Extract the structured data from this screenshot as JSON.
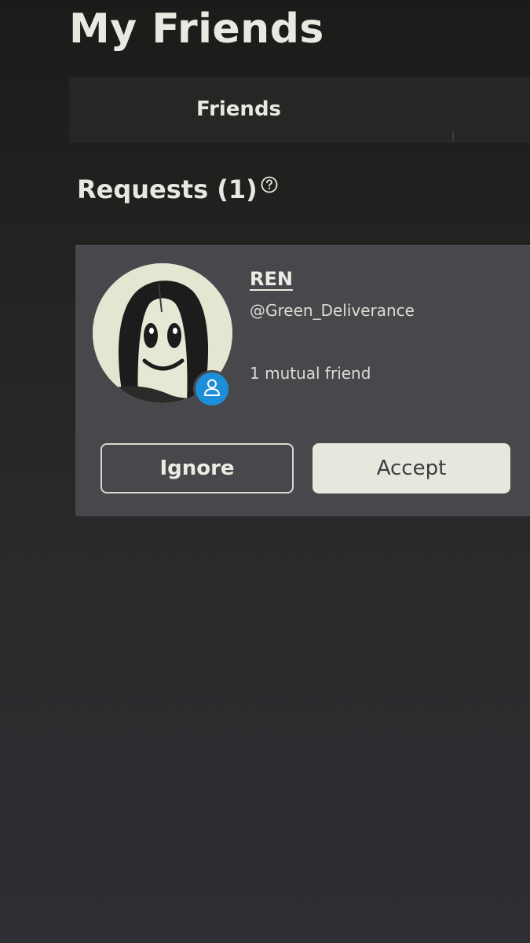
{
  "page": {
    "title": "My Friends"
  },
  "tabs": [
    {
      "label": "Friends"
    }
  ],
  "requests": {
    "title": "Requests (1)",
    "help_icon": "question-circle-icon",
    "items": [
      {
        "display_name": "REN",
        "username": "@Green_Deliverance",
        "mutual": "1 mutual friend",
        "presence_icon": "person-icon",
        "presence_color": "#1d8fd8",
        "ignore_label": "Ignore",
        "accept_label": "Accept"
      }
    ]
  }
}
